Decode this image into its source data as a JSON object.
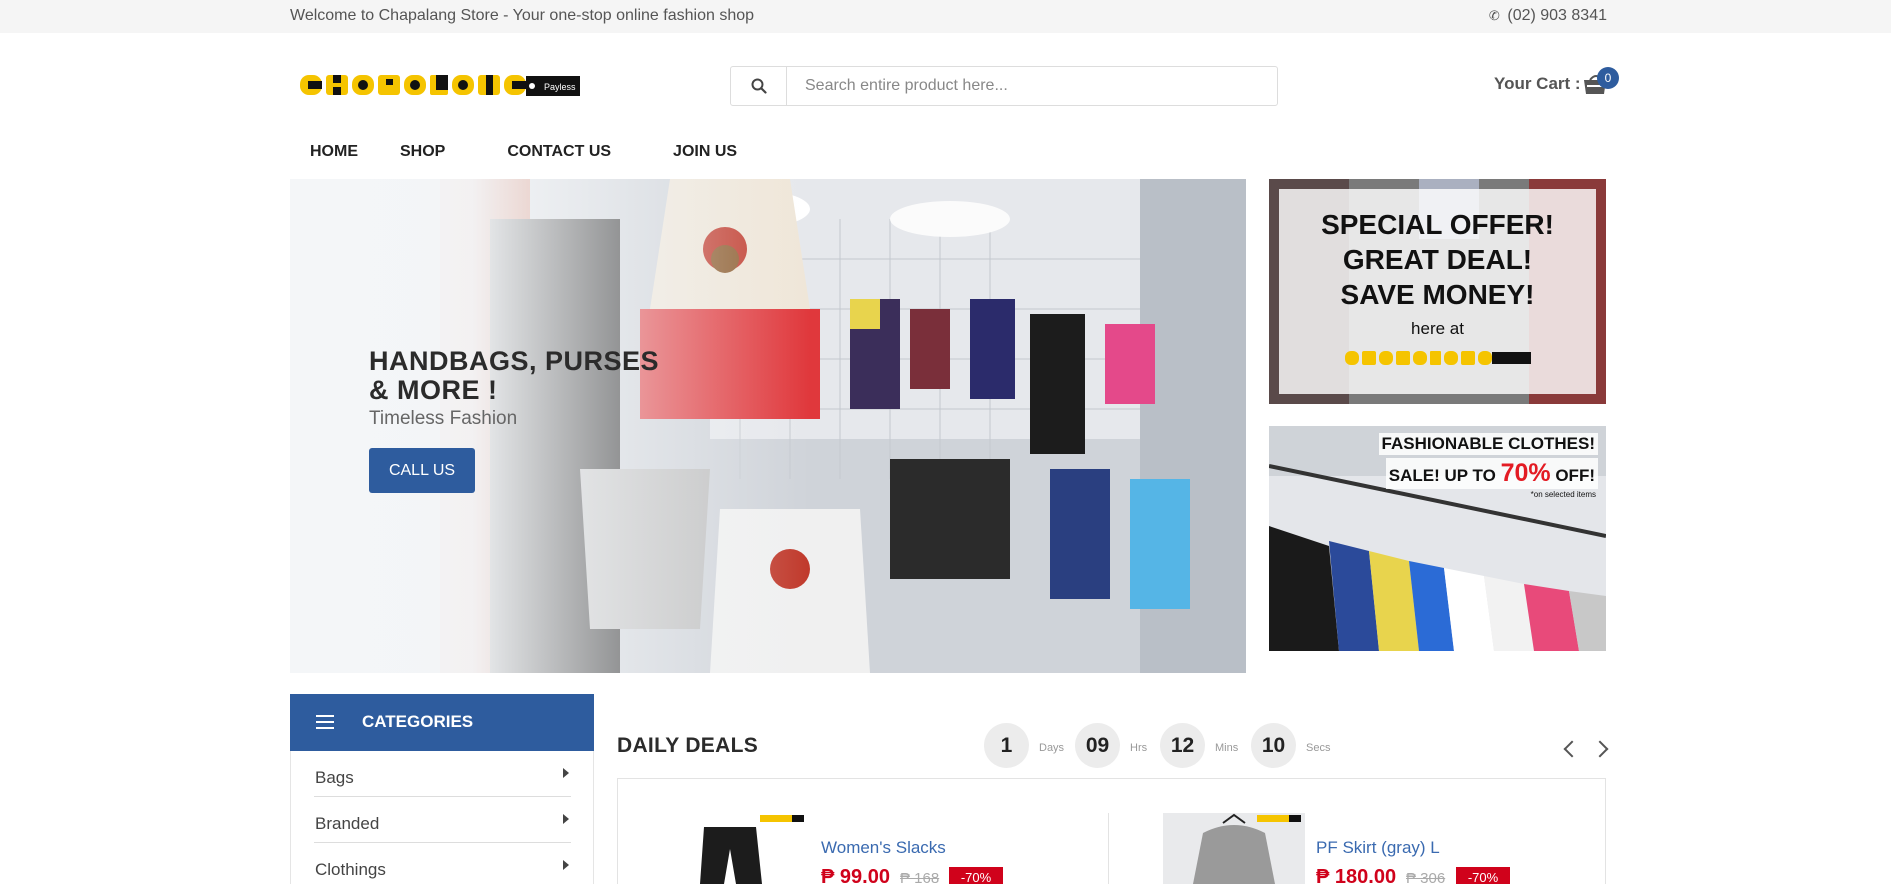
{
  "topbar": {
    "welcome": "Welcome to Chapalang Store - Your one-stop online fashion shop",
    "phone": "(02) 903 8341"
  },
  "header": {
    "logo_text": "CHAPALANG",
    "logo_tag": "Payless",
    "search_placeholder": "Search entire product here...",
    "cart_label": "Your Cart :",
    "cart_count": "0"
  },
  "nav": {
    "items": [
      "HOME",
      "SHOP",
      "CONTACT US",
      "JOIN US"
    ]
  },
  "hero": {
    "title": "HANDBAGS, PURSES & MORE !",
    "subtitle": "Timeless Fashion",
    "button": "CALL US"
  },
  "side_banners": {
    "offer": {
      "line1": "SPECIAL OFFER!",
      "line2": "GREAT DEAL!",
      "line3": "SAVE MONEY!",
      "line4": "here at"
    },
    "sale": {
      "line1": "FASHIONABLE CLOTHES!",
      "line2_prefix": "SALE! UP TO ",
      "percent": "70%",
      "line2_suffix": " OFF!",
      "note": "*on selected items"
    }
  },
  "categories": {
    "title": "CATEGORIES",
    "items": [
      "Bags",
      "Branded",
      "Clothings"
    ]
  },
  "daily_deals": {
    "title": "DAILY DEALS",
    "countdown": {
      "days": "1",
      "days_label": "Days",
      "hrs": "09",
      "hrs_label": "Hrs",
      "mins": "12",
      "mins_label": "Mins",
      "secs": "10",
      "secs_label": "Secs"
    },
    "products": [
      {
        "name": "Women's Slacks",
        "price": "₱ 99.00",
        "old_price": "₱ 168",
        "discount": "-70%"
      },
      {
        "name": "PF Skirt (gray) L",
        "price": "₱ 180.00",
        "old_price": "₱ 306",
        "discount": "-70%"
      }
    ]
  },
  "colors": {
    "brand_blue": "#2e5c9e",
    "sale_red": "#d0021b",
    "logo_yellow": "#f5c400"
  }
}
